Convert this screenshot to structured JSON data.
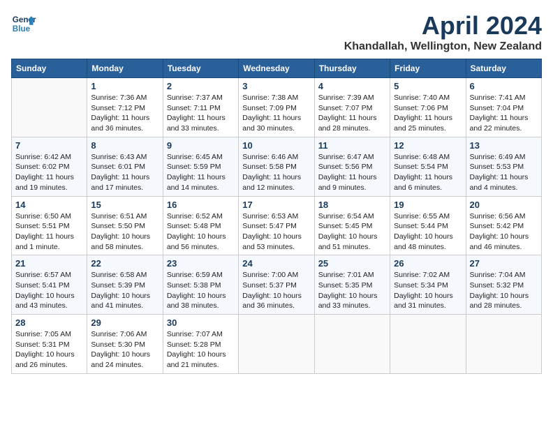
{
  "header": {
    "logo_line1": "General",
    "logo_line2": "Blue",
    "month_title": "April 2024",
    "location": "Khandallah, Wellington, New Zealand"
  },
  "days_of_week": [
    "Sunday",
    "Monday",
    "Tuesday",
    "Wednesday",
    "Thursday",
    "Friday",
    "Saturday"
  ],
  "weeks": [
    [
      {
        "day": "",
        "content": ""
      },
      {
        "day": "1",
        "content": "Sunrise: 7:36 AM\nSunset: 7:12 PM\nDaylight: 11 hours\nand 36 minutes."
      },
      {
        "day": "2",
        "content": "Sunrise: 7:37 AM\nSunset: 7:11 PM\nDaylight: 11 hours\nand 33 minutes."
      },
      {
        "day": "3",
        "content": "Sunrise: 7:38 AM\nSunset: 7:09 PM\nDaylight: 11 hours\nand 30 minutes."
      },
      {
        "day": "4",
        "content": "Sunrise: 7:39 AM\nSunset: 7:07 PM\nDaylight: 11 hours\nand 28 minutes."
      },
      {
        "day": "5",
        "content": "Sunrise: 7:40 AM\nSunset: 7:06 PM\nDaylight: 11 hours\nand 25 minutes."
      },
      {
        "day": "6",
        "content": "Sunrise: 7:41 AM\nSunset: 7:04 PM\nDaylight: 11 hours\nand 22 minutes."
      }
    ],
    [
      {
        "day": "7",
        "content": "Sunrise: 6:42 AM\nSunset: 6:02 PM\nDaylight: 11 hours\nand 19 minutes."
      },
      {
        "day": "8",
        "content": "Sunrise: 6:43 AM\nSunset: 6:01 PM\nDaylight: 11 hours\nand 17 minutes."
      },
      {
        "day": "9",
        "content": "Sunrise: 6:45 AM\nSunset: 5:59 PM\nDaylight: 11 hours\nand 14 minutes."
      },
      {
        "day": "10",
        "content": "Sunrise: 6:46 AM\nSunset: 5:58 PM\nDaylight: 11 hours\nand 12 minutes."
      },
      {
        "day": "11",
        "content": "Sunrise: 6:47 AM\nSunset: 5:56 PM\nDaylight: 11 hours\nand 9 minutes."
      },
      {
        "day": "12",
        "content": "Sunrise: 6:48 AM\nSunset: 5:54 PM\nDaylight: 11 hours\nand 6 minutes."
      },
      {
        "day": "13",
        "content": "Sunrise: 6:49 AM\nSunset: 5:53 PM\nDaylight: 11 hours\nand 4 minutes."
      }
    ],
    [
      {
        "day": "14",
        "content": "Sunrise: 6:50 AM\nSunset: 5:51 PM\nDaylight: 11 hours\nand 1 minute."
      },
      {
        "day": "15",
        "content": "Sunrise: 6:51 AM\nSunset: 5:50 PM\nDaylight: 10 hours\nand 58 minutes."
      },
      {
        "day": "16",
        "content": "Sunrise: 6:52 AM\nSunset: 5:48 PM\nDaylight: 10 hours\nand 56 minutes."
      },
      {
        "day": "17",
        "content": "Sunrise: 6:53 AM\nSunset: 5:47 PM\nDaylight: 10 hours\nand 53 minutes."
      },
      {
        "day": "18",
        "content": "Sunrise: 6:54 AM\nSunset: 5:45 PM\nDaylight: 10 hours\nand 51 minutes."
      },
      {
        "day": "19",
        "content": "Sunrise: 6:55 AM\nSunset: 5:44 PM\nDaylight: 10 hours\nand 48 minutes."
      },
      {
        "day": "20",
        "content": "Sunrise: 6:56 AM\nSunset: 5:42 PM\nDaylight: 10 hours\nand 46 minutes."
      }
    ],
    [
      {
        "day": "21",
        "content": "Sunrise: 6:57 AM\nSunset: 5:41 PM\nDaylight: 10 hours\nand 43 minutes."
      },
      {
        "day": "22",
        "content": "Sunrise: 6:58 AM\nSunset: 5:39 PM\nDaylight: 10 hours\nand 41 minutes."
      },
      {
        "day": "23",
        "content": "Sunrise: 6:59 AM\nSunset: 5:38 PM\nDaylight: 10 hours\nand 38 minutes."
      },
      {
        "day": "24",
        "content": "Sunrise: 7:00 AM\nSunset: 5:37 PM\nDaylight: 10 hours\nand 36 minutes."
      },
      {
        "day": "25",
        "content": "Sunrise: 7:01 AM\nSunset: 5:35 PM\nDaylight: 10 hours\nand 33 minutes."
      },
      {
        "day": "26",
        "content": "Sunrise: 7:02 AM\nSunset: 5:34 PM\nDaylight: 10 hours\nand 31 minutes."
      },
      {
        "day": "27",
        "content": "Sunrise: 7:04 AM\nSunset: 5:32 PM\nDaylight: 10 hours\nand 28 minutes."
      }
    ],
    [
      {
        "day": "28",
        "content": "Sunrise: 7:05 AM\nSunset: 5:31 PM\nDaylight: 10 hours\nand 26 minutes."
      },
      {
        "day": "29",
        "content": "Sunrise: 7:06 AM\nSunset: 5:30 PM\nDaylight: 10 hours\nand 24 minutes."
      },
      {
        "day": "30",
        "content": "Sunrise: 7:07 AM\nSunset: 5:28 PM\nDaylight: 10 hours\nand 21 minutes."
      },
      {
        "day": "",
        "content": ""
      },
      {
        "day": "",
        "content": ""
      },
      {
        "day": "",
        "content": ""
      },
      {
        "day": "",
        "content": ""
      }
    ]
  ]
}
